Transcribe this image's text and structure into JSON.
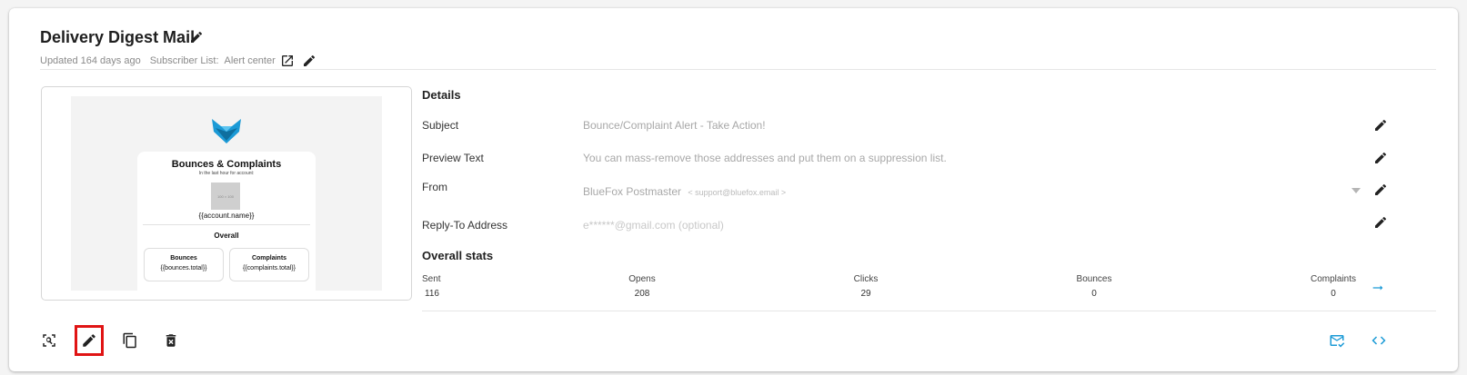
{
  "header": {
    "title": "Delivery Digest Mail",
    "updated": "Updated 164 days ago",
    "subscriber_list_label": "Subscriber List:",
    "subscriber_list_name": "Alert center"
  },
  "preview": {
    "card_title": "Bounces & Complaints",
    "card_subtitle": "In the last hour for account:",
    "image_placeholder": "100 × 100",
    "account_var": "{{account.name}}",
    "overall": "Overall",
    "boxes": [
      {
        "title": "Bounces",
        "value": "{{bounces.total}}"
      },
      {
        "title": "Complaints",
        "value": "{{complaints.total}}"
      }
    ]
  },
  "details": {
    "heading": "Details",
    "subject_label": "Subject",
    "subject_value": "Bounce/Complaint Alert - Take Action!",
    "preview_label": "Preview Text",
    "preview_value": "You can mass-remove those addresses and put them on a suppression list.",
    "from_label": "From",
    "from_name": "BlueFox Postmaster",
    "from_email": "< support@bluefox.email >",
    "reply_label": "Reply-To Address",
    "reply_placeholder": "e******@gmail.com (optional)"
  },
  "stats": {
    "heading": "Overall stats",
    "items": [
      {
        "label": "Sent",
        "value": "116"
      },
      {
        "label": "Opens",
        "value": "208"
      },
      {
        "label": "Clicks",
        "value": "29"
      },
      {
        "label": "Bounces",
        "value": "0"
      },
      {
        "label": "Complaints",
        "value": "0"
      }
    ]
  },
  "toolbar": {
    "icons": [
      "preview-zoom-icon",
      "edit-icon",
      "duplicate-icon",
      "delete-icon",
      "send-test-icon",
      "code-icon"
    ],
    "selected": "edit-icon"
  },
  "colors": {
    "accent": "#1b9ad6",
    "highlight": "#e01414",
    "logo": "#1b9ad6"
  }
}
